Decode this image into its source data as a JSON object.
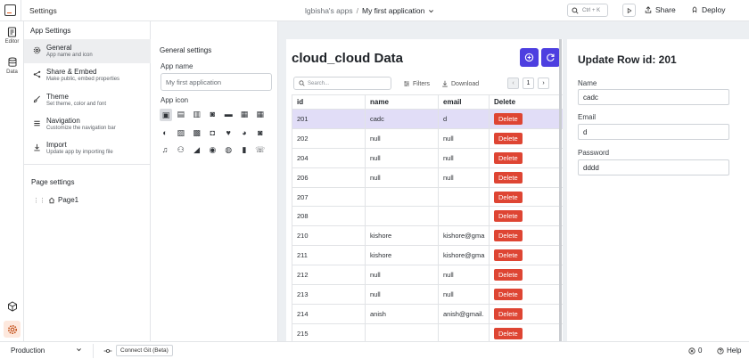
{
  "topbar": {
    "title": "Settings",
    "workspace": "lgbisha's apps",
    "separator": "/",
    "app_name": "My first application",
    "search_shortcut": "Ctrl + K",
    "share_label": "Share",
    "deploy_label": "Deploy"
  },
  "rail": {
    "editor_label": "Editor",
    "data_label": "Data"
  },
  "settings": {
    "heading": "App Settings",
    "items": [
      {
        "title": "General",
        "subtitle": "App name and icon"
      },
      {
        "title": "Share & Embed",
        "subtitle": "Make public, embed properties"
      },
      {
        "title": "Theme",
        "subtitle": "Set theme, color and font"
      },
      {
        "title": "Navigation",
        "subtitle": "Customize the navigation bar"
      },
      {
        "title": "Import",
        "subtitle": "Update app by importing file"
      }
    ],
    "page_settings_heading": "Page settings",
    "pages": [
      "Page1"
    ]
  },
  "general": {
    "title": "General settings",
    "app_name_label": "App name",
    "app_name_value": "My first application",
    "app_icon_label": "App icon",
    "icons": [
      "bus-icon",
      "inbox-icon",
      "book-icon",
      "camera-icon",
      "folder-icon",
      "message-icon",
      "calendar-icon",
      "globe-icon",
      "image-icon",
      "chart-icon",
      "bag-icon",
      "heart-icon",
      "alien-icon",
      "camera-alt-icon",
      "music-icon",
      "bicycle-icon",
      "rocket-icon",
      "disc-icon",
      "basketball-icon",
      "train-icon",
      "phone-icon"
    ]
  },
  "table": {
    "title": "cloud_cloud Data",
    "search_placeholder": "Search...",
    "filters_label": "Filters",
    "download_label": "Download",
    "page_number": "1",
    "columns": [
      "id",
      "name",
      "email",
      "Delete"
    ],
    "delete_label": "Delete",
    "rows": [
      {
        "id": "201",
        "name": "cadc",
        "email": "d"
      },
      {
        "id": "202",
        "name": "null",
        "email": "null"
      },
      {
        "id": "204",
        "name": "null",
        "email": "null"
      },
      {
        "id": "206",
        "name": "null",
        "email": "null"
      },
      {
        "id": "207",
        "name": "",
        "email": ""
      },
      {
        "id": "208",
        "name": "",
        "email": ""
      },
      {
        "id": "210",
        "name": "kishore",
        "email": "kishore@gma"
      },
      {
        "id": "211",
        "name": "kishore",
        "email": "kishore@gma"
      },
      {
        "id": "212",
        "name": "null",
        "email": "null"
      },
      {
        "id": "213",
        "name": "null",
        "email": "null"
      },
      {
        "id": "214",
        "name": "anish",
        "email": "anish@gmail."
      },
      {
        "id": "215",
        "name": "",
        "email": ""
      }
    ]
  },
  "form": {
    "title": "Update Row id: 201",
    "name_label": "Name",
    "name_value": "cadc",
    "email_label": "Email",
    "email_value": "d",
    "password_label": "Password",
    "password_value": "dddd"
  },
  "bottombar": {
    "environment": "Production",
    "git_label": "Connect Git (Beta)",
    "error_count": "0",
    "help_label": "Help"
  },
  "colors": {
    "accent": "#4d3fe0",
    "danger": "#de4533",
    "selected_row": "#e1ddf7",
    "brand_orange": "#e15615"
  }
}
